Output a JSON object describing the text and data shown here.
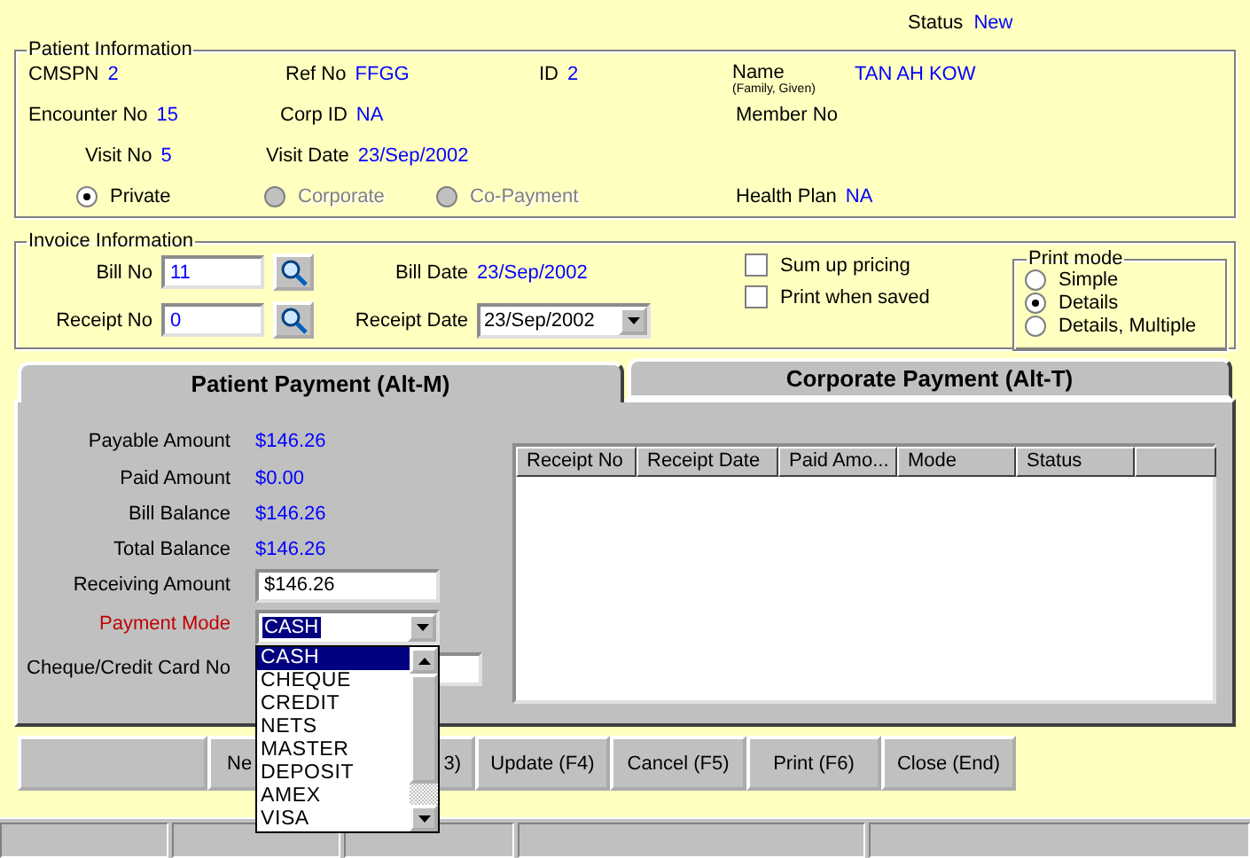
{
  "status": {
    "label": "Status",
    "value": "New"
  },
  "patient_information": {
    "title": "Patient Information",
    "rows": [
      [
        {
          "label": "CMSPN",
          "value": "2"
        },
        {
          "label": "Ref No",
          "value": "FFGG"
        },
        {
          "label": "ID",
          "value": "2"
        },
        {
          "label": "Name",
          "sublabel": "(Family, Given)",
          "value": "TAN AH KOW"
        }
      ],
      [
        {
          "label": "Encounter No",
          "value": "15"
        },
        {
          "label": "Corp ID",
          "value": "NA"
        },
        "",
        {
          "label": "Member No"
        }
      ],
      [
        {
          "label": "Visit No",
          "value": "5"
        },
        {
          "label": "Visit Date",
          "value": "23/Sep/2002"
        }
      ]
    ],
    "payer_options": [
      {
        "label": "Private",
        "selected": true,
        "disabled": false
      },
      {
        "label": "Corporate",
        "selected": false,
        "disabled": true
      },
      {
        "label": "Co-Payment",
        "selected": false,
        "disabled": true
      }
    ],
    "health_plan": {
      "label": "Health Plan",
      "value": "NA"
    }
  },
  "invoice_information": {
    "title": "Invoice Information",
    "bill_no": {
      "label": "Bill No",
      "value": "11"
    },
    "receipt_no": {
      "label": "Receipt No",
      "value": "0"
    },
    "bill_date": {
      "label": "Bill Date",
      "value": "23/Sep/2002"
    },
    "receipt_date": {
      "label": "Receipt Date",
      "value": "23/Sep/2002"
    },
    "checkboxes": [
      {
        "label": "Sum up pricing",
        "checked": false
      },
      {
        "label": "Print when saved",
        "checked": false
      }
    ],
    "print_mode": {
      "title": "Print mode",
      "options": [
        {
          "label": "Simple",
          "selected": false
        },
        {
          "label": "Details",
          "selected": true
        },
        {
          "label": "Details, Multiple",
          "selected": false
        }
      ]
    }
  },
  "tabs": [
    {
      "label": "Patient Payment (Alt-M)",
      "selected": true
    },
    {
      "label": "Corporate Payment (Alt-T)",
      "selected": false
    }
  ],
  "payment": {
    "amounts": [
      {
        "label": "Payable Amount",
        "value": "$146.26"
      },
      {
        "label": "Paid Amount",
        "value": "$0.00"
      },
      {
        "label": "Bill Balance",
        "value": "$146.26"
      },
      {
        "label": "Total Balance",
        "value": "$146.26"
      }
    ],
    "receiving_amount": {
      "label": "Receiving Amount",
      "value": "$146.26"
    },
    "payment_mode": {
      "label": "Payment Mode",
      "required": true,
      "value": "CASH",
      "options": [
        {
          "label": "CASH",
          "selected": true
        },
        {
          "label": "CHEQUE",
          "selected": false
        },
        {
          "label": "CREDIT",
          "selected": false
        },
        {
          "label": "NETS",
          "selected": false
        },
        {
          "label": "MASTER",
          "selected": false
        },
        {
          "label": "DEPOSIT",
          "selected": false
        },
        {
          "label": "AMEX",
          "selected": false
        },
        {
          "label": "VISA",
          "selected": false
        }
      ]
    },
    "card_no": {
      "label": "Cheque/Credit Card No"
    }
  },
  "table": {
    "columns": [
      "Receipt No",
      "Receipt Date",
      "Paid Amo...",
      "Mode",
      "Status",
      ""
    ]
  },
  "buttons": [
    {
      "parts": [
        "Ne",
        "3)"
      ]
    },
    {
      "parts": [
        "Update (F4)"
      ]
    },
    {
      "parts": [
        "Cancel (F5)"
      ]
    },
    {
      "parts": [
        "Print (F6)"
      ]
    },
    {
      "parts": [
        "Close (End)"
      ]
    }
  ]
}
